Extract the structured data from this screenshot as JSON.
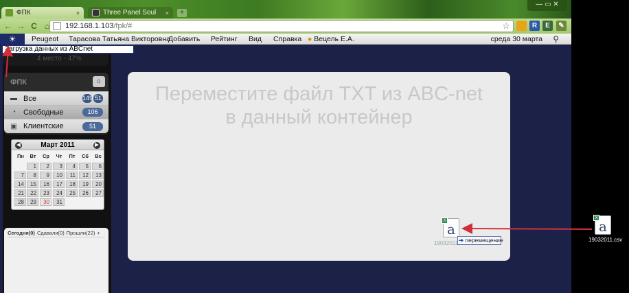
{
  "browser": {
    "tabs": [
      {
        "title": "ФПК",
        "close": "×"
      },
      {
        "title": "Three Panel Soul",
        "close": "×"
      }
    ],
    "new_tab": "+",
    "window_controls": "— ▭ ✕",
    "nav": {
      "back": "←",
      "forward": "→",
      "reload": "C",
      "home": "⌂"
    },
    "url_host": "192.168.1.103",
    "url_path": "/fpk/#",
    "star": "☆",
    "extensions": [
      "R",
      "E"
    ]
  },
  "menubar": {
    "logo": "☀",
    "items": [
      "Peugeot",
      "Тарасова Татьяна Викторовна",
      "Добавить",
      "Рейтинг",
      "Вид",
      "Справка",
      "Вецель Е.А."
    ],
    "date": "среда 30 марта",
    "search_icon": "⚲"
  },
  "dropdown_item": "Загрузка данных из ABCnet",
  "left": {
    "stub_text": "4 место - 47%",
    "fpk_title": "ФПК",
    "home": "⌂",
    "rows": [
      {
        "label": "Все",
        "badge": "149",
        "badge2": "51"
      },
      {
        "label": "Свободные",
        "badge": "106"
      },
      {
        "label": "Клиентские",
        "badge": "51"
      }
    ]
  },
  "calendar": {
    "title": "Март 2011",
    "prev": "◀",
    "next": "▶",
    "dow": [
      "Пн",
      "Вт",
      "Ср",
      "Чт",
      "Пт",
      "Сб",
      "Вс"
    ],
    "weeks": [
      [
        "",
        "1",
        "2",
        "3",
        "4",
        "5",
        "6"
      ],
      [
        "7",
        "8",
        "9",
        "10",
        "11",
        "12",
        "13"
      ],
      [
        "14",
        "15",
        "16",
        "17",
        "18",
        "19",
        "20"
      ],
      [
        "21",
        "22",
        "23",
        "24",
        "25",
        "26",
        "27"
      ],
      [
        "28",
        "29",
        "30",
        "31",
        "",
        "",
        ""
      ]
    ],
    "today": "30"
  },
  "bottom_tabs": {
    "today": "Сегодня(0)",
    "done": "Сдавали(0)",
    "past": "Прошли(22)",
    "add": "+"
  },
  "dropzone": {
    "line1": "Переместите файл TXT из ABC-net",
    "line2": "в данный контейнер"
  },
  "drag": {
    "tooltip": "перемещение",
    "ghost_label": "19032011.csv"
  },
  "desktop": {
    "file_label": "19032011.csv"
  },
  "colors": {
    "arrow": "#d0303a",
    "app_bg": "#1c2148",
    "menu_logo": "#1d2b66"
  }
}
